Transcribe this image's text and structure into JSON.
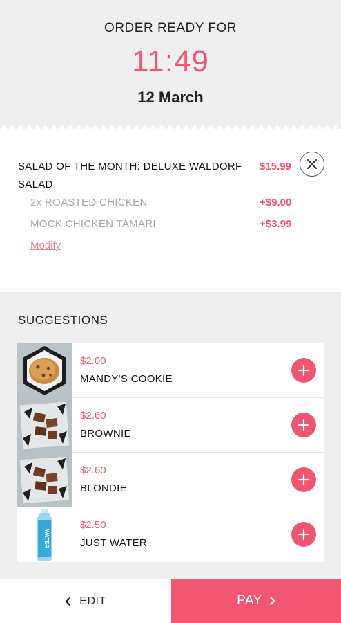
{
  "header": {
    "ready_label": "ORDER READY FOR",
    "time": "11:49",
    "date": "12 March"
  },
  "order_item": {
    "name": "SALAD OF THE MONTH: DELUXE WALDORF SALAD",
    "price": "$15.99",
    "modifiers": [
      {
        "label": "2x ROASTED CHICKEN",
        "price": "+$9.00"
      },
      {
        "label": "MOCK CHICKEN TAMARI",
        "price": "+$3.99"
      }
    ],
    "modify_label": "Modify"
  },
  "suggestions": {
    "title": "SUGGESTIONS",
    "items": [
      {
        "price": "$2.00",
        "name": "MANDY'S COOKIE",
        "thumb": "cookie"
      },
      {
        "price": "$2.60",
        "name": "BROWNIE",
        "thumb": "brownie"
      },
      {
        "price": "$2.60",
        "name": "BLONDIE",
        "thumb": "blondie"
      },
      {
        "price": "$2.50",
        "name": "JUST WATER",
        "thumb": "water",
        "thumb_text": "WATER"
      }
    ]
  },
  "footer": {
    "edit_label": "EDIT",
    "pay_label": "PAY"
  },
  "colors": {
    "accent": "#f0566f",
    "background": "#efefef"
  }
}
